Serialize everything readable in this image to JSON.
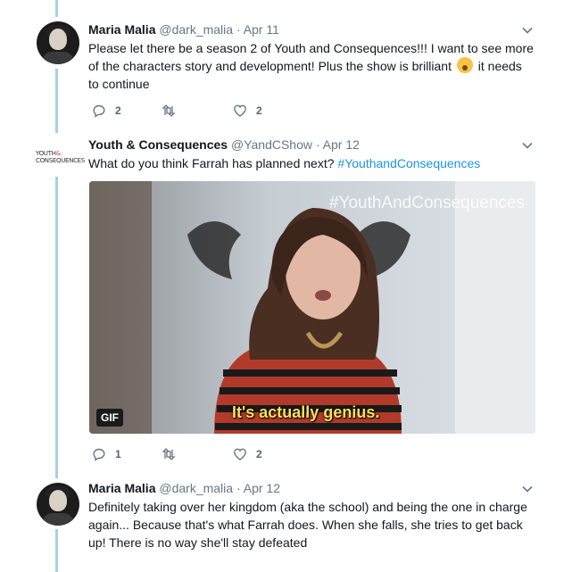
{
  "tweets": [
    {
      "name": "Maria Malia",
      "handle": "@dark_malia",
      "separator": "·",
      "date": "Apr 11",
      "text_lines": [
        "Please let there be a season 2 of Youth and Consequences!!! I want to see more",
        "of the characters story and development! Plus the show is brilliant",
        "it needs",
        "to continue"
      ],
      "reply_count": "2",
      "retweet_count": "",
      "like_count": "2"
    },
    {
      "name": "Youth & Consequences",
      "handle": "@YandCShow",
      "separator": "·",
      "date": "Apr 12",
      "text": "What do you think Farrah has planned next?",
      "hashtag": "#YouthandConsequences",
      "logo_line1": "YOUTH",
      "logo_amp": "&",
      "logo_line2": "CONSEQUENCES",
      "media": {
        "hashtag_overlay": "#YouthAndConsequences",
        "caption": "It's actually genius.",
        "badge": "GIF"
      },
      "reply_count": "1",
      "retweet_count": "",
      "like_count": "2"
    },
    {
      "name": "Maria Malia",
      "handle": "@dark_malia",
      "separator": "·",
      "date": "Apr 12",
      "text_lines": [
        "Definitely taking over her kingdom (aka the school) and being the one in charge",
        "again... Because that's what Farrah does. When she falls, she tries to get back",
        "up! There is no way she'll stay defeated"
      ]
    }
  ],
  "colors": {
    "thread_line": "#a9cfe6",
    "hashtag": "#1b95e0",
    "meta_text": "#657786",
    "caption_yellow": "#f4e25a"
  },
  "icons": [
    "reply-icon",
    "retweet-icon",
    "like-icon",
    "chevron-down-icon",
    "emoji-scream-icon"
  ]
}
